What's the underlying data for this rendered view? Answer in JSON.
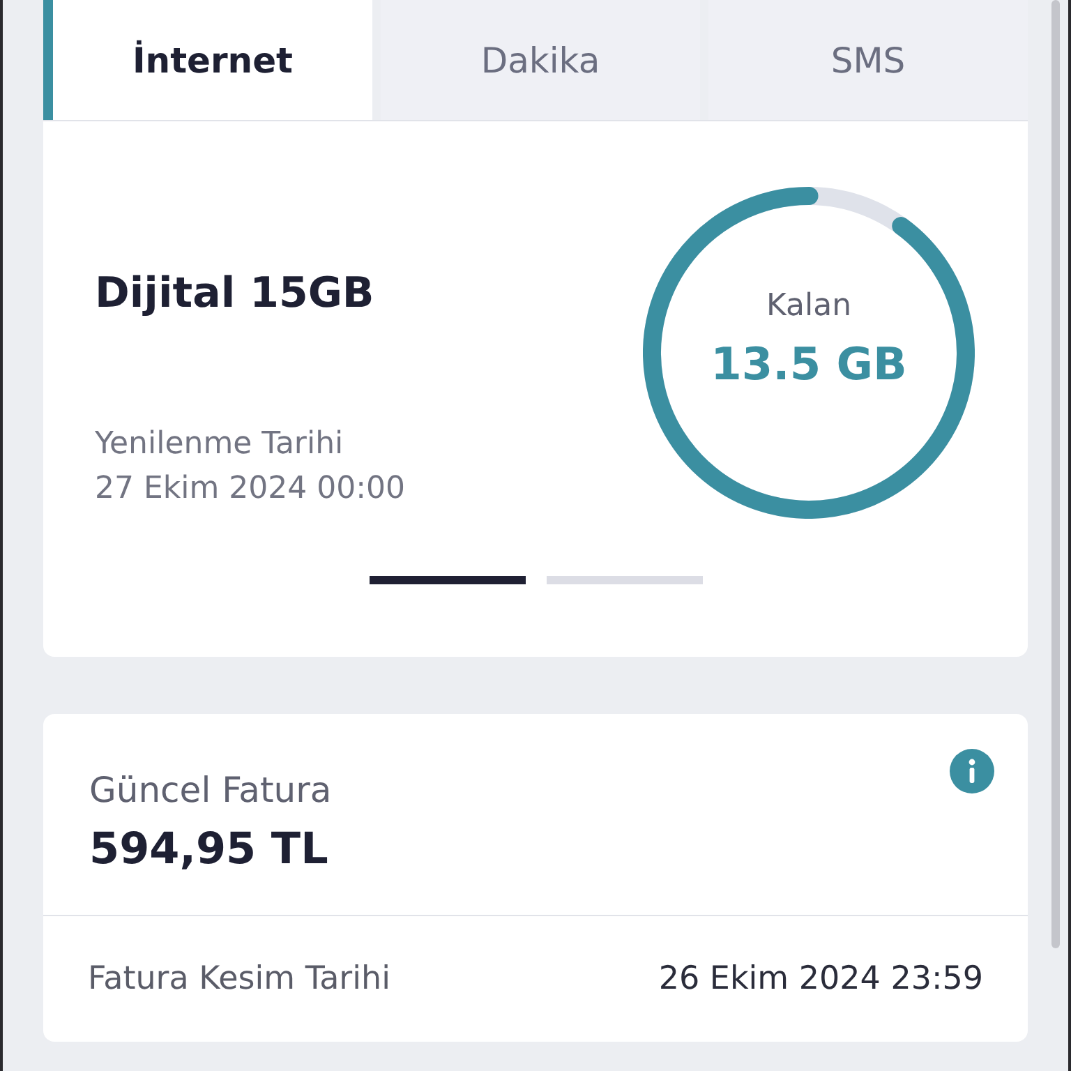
{
  "tabs": [
    {
      "label": "İnternet",
      "selected": true
    },
    {
      "label": "Dakika",
      "selected": false
    },
    {
      "label": "SMS",
      "selected": false
    }
  ],
  "package": {
    "name": "Dijital 15GB",
    "renewal_label": "Yenilenme Tarihi",
    "renewal_date": "27 Ekim 2024 00:00",
    "gauge": {
      "label": "Kalan",
      "value": "13.5 GB",
      "level": 0.9
    }
  },
  "pager": [
    {
      "selected": true
    },
    {
      "selected": false
    }
  ],
  "bill": {
    "title": "Güncel Fatura",
    "amount": "594,95 TL",
    "cutoff_label": "Fatura Kesim Tarihi",
    "cutoff_date": "26 Ekim 2024 23:59"
  }
}
